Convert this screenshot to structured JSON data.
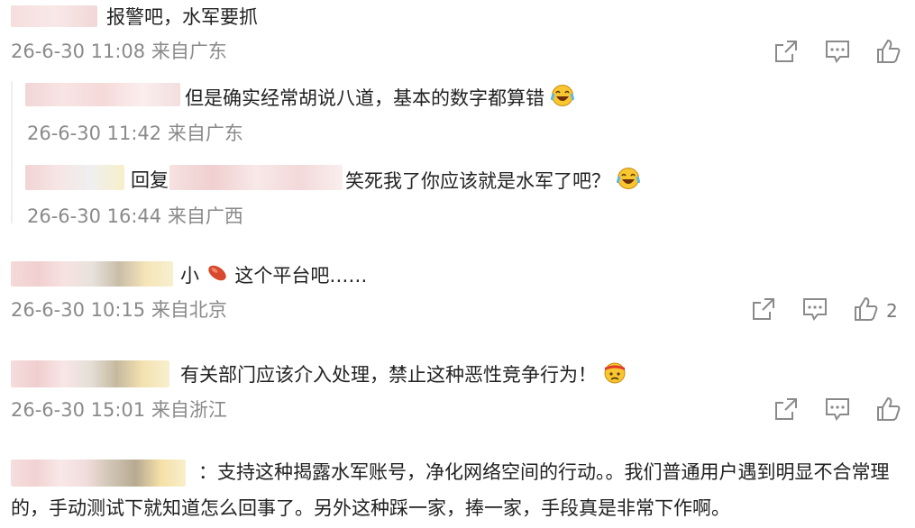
{
  "comments": [
    {
      "text": "报警吧，水军要抓",
      "meta": "26-6-30 11:08 来自广东",
      "replies": [
        {
          "text": "但是确实经常胡说八道，基本的数字都算错",
          "meta": "26-6-30 11:42 来自广东"
        },
        {
          "reply_prefix": "回复",
          "text": "笑死我了你应该就是水军了吧？",
          "meta": "26-6-30 16:44 来自广西"
        }
      ]
    },
    {
      "text": "小",
      "text_after": "这个平台吧……",
      "meta": "26-6-30 10:15 来自北京",
      "likes": "2"
    },
    {
      "text": "有关部门应该介入处理，禁止这种恶性竞争行为！",
      "meta": "26-6-30 15:01 来自浙江"
    },
    {
      "text": "：支持这种揭露水军账号，净化网络空间的行动。。我们普通用户遇到明显不合常理的，手动测试下就知道怎么回事了。另外这种踩一家，捧一家，手段真是非常下作啊。"
    }
  ],
  "icons": {
    "share": "share-icon",
    "comment": "comment-icon",
    "like": "like-icon",
    "laugh": "laughing-emoji-icon",
    "sweet_potato": "sweet-potato-emoji-icon",
    "angry": "angry-headband-emoji-icon"
  }
}
